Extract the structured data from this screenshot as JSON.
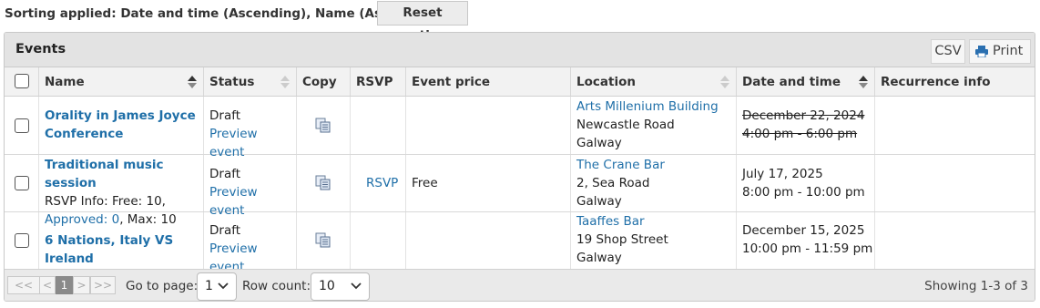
{
  "sorting": {
    "text": "Sorting applied: Date and time (Ascending), Name (Ascending)",
    "reset_label": "Reset sorting"
  },
  "panel": {
    "title": "Events",
    "csv_label": "CSV",
    "print_label": "Print"
  },
  "columns": {
    "name": "Name",
    "status": "Status",
    "copy": "Copy",
    "rsvp": "RSVP",
    "price": "Event price",
    "location": "Location",
    "datetime": "Date and time",
    "recurrence": "Recurrence info"
  },
  "rows": [
    {
      "name_line1": "Orality in James Joyce",
      "name_line2": "Conference",
      "status": "Draft",
      "preview": "Preview event",
      "location_link": "Arts Millenium Building",
      "location_line2": "Newcastle Road",
      "location_line3": "Galway",
      "date": "December 22, 2024",
      "time": "4:00 pm - 6:00 pm"
    },
    {
      "name": "Traditional music session",
      "rsvp_info_prefix": "RSVP Info: Free: 10,",
      "approved": "Approved: 0",
      "max": ", Max: 10",
      "status": "Draft",
      "preview": "Preview event",
      "rsvp": "RSVP",
      "price": "Free",
      "location_link": "The Crane Bar",
      "location_line2": "2, Sea Road",
      "location_line3": "Galway",
      "date": "July 17, 2025",
      "time": "8:00 pm - 10:00 pm"
    },
    {
      "name": "6 Nations, Italy VS Ireland",
      "status": "Draft",
      "preview": "Preview event",
      "location_link": "Taaffes Bar",
      "location_line2": "19 Shop Street",
      "location_line3": "Galway",
      "date": "December 15, 2025",
      "time": "10:00 pm - 11:59 pm"
    }
  ],
  "footer": {
    "first": "<<",
    "prev": "<",
    "page": "1",
    "next": ">",
    "last": ">>",
    "goto_label": "Go to page:",
    "goto_value": "1",
    "rowcount_label": "Row count:",
    "rowcount_value": "10",
    "showing": "Showing 1-3 of 3"
  },
  "colors": {
    "link": "#1f6fa8",
    "header_bg": "#e3e3e3",
    "active_page": "#8a8a8a"
  }
}
